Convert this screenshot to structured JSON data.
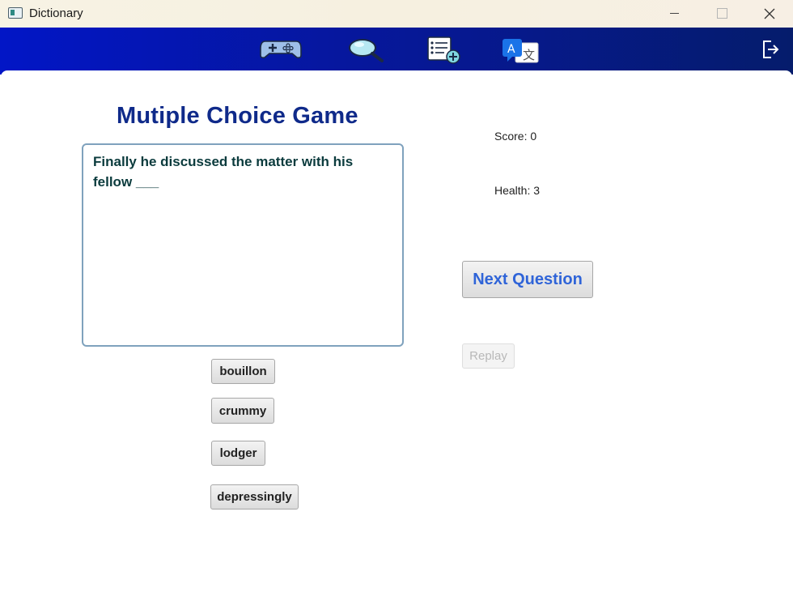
{
  "window": {
    "title": "Dictionary",
    "icons": [
      "app-icon",
      "minimize-icon",
      "maximize-icon",
      "close-icon"
    ]
  },
  "toolbar": {
    "icons": [
      "game-controller-icon",
      "magnifier-icon",
      "add-list-icon",
      "translate-icon",
      "logout-icon"
    ],
    "accent_gradient": [
      "#0216c6",
      "#051c6c"
    ]
  },
  "game": {
    "title": "Mutiple Choice Game",
    "question": "Finally he discussed the matter with his fellow ___",
    "score_label": "Score: 0",
    "health_label": "Health: 3",
    "next_button": "Next Question",
    "replay_button": "Replay",
    "options": [
      "bouillon",
      "crummy",
      "lodger",
      "depressingly"
    ]
  },
  "colors": {
    "title": "#0f2a8a",
    "next_button_text": "#2f64d8",
    "question_text": "#0b3b3d",
    "question_border": "#7fa2bd"
  }
}
